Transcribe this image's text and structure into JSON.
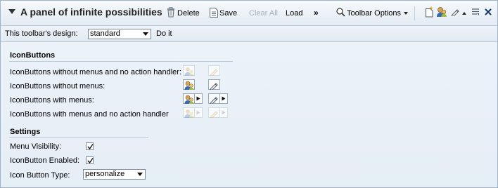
{
  "panel": {
    "title": "A panel of infinite possibilities"
  },
  "toolbar": {
    "delete_label": "Delete",
    "save_label": "Save",
    "clear_all_label": "Clear All",
    "load_label": "Load",
    "overflow_label": "»",
    "options_label": "Toolbar Options"
  },
  "design_bar": {
    "label": "This toolbar's design:",
    "selected_design": "standard",
    "do_it_label": "Do it"
  },
  "iconbuttons_section": {
    "title": "IconButtons",
    "rows": [
      {
        "label": "IconButtons without menus and no action handler:"
      },
      {
        "label": "IconButtons without menus:"
      },
      {
        "label": "IconButtons with menus:"
      },
      {
        "label": "IconButtons with menus and no action handler"
      }
    ]
  },
  "settings_section": {
    "title": "Settings",
    "menu_visibility_label": "Menu Visibility:",
    "menu_visibility_checked": true,
    "iconbutton_enabled_label": "IconButton Enabled:",
    "iconbutton_enabled_checked": true,
    "icon_button_type_label": "Icon Button Type:",
    "icon_button_type_value": "personalize"
  },
  "colors": {
    "panel_bg": "#e6eef6",
    "border": "#9fb3c8",
    "disabled_text": "#a4b0bd",
    "close_red": "#1b3d6b"
  },
  "icons": [
    "collapse-arrow-icon",
    "delete-icon",
    "save-icon",
    "search-icon",
    "new-icon",
    "personalize-icon",
    "pencil-icon",
    "list-icon",
    "close-icon"
  ]
}
